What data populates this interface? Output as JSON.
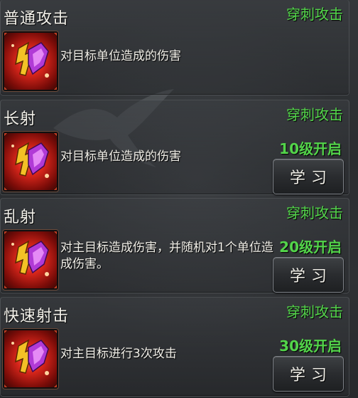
{
  "skills": [
    {
      "name": "普通攻击",
      "type": "穿刺攻击",
      "description": "对目标单位造成的伤害",
      "level_req": "",
      "learn_label": "",
      "icon": "flame-shield-icon"
    },
    {
      "name": "长射",
      "type": "穿刺攻击",
      "description": "对目标单位造成的伤害",
      "level_req": "10级开启",
      "learn_label": "学习",
      "icon": "flame-shield-icon"
    },
    {
      "name": "乱射",
      "type": "穿刺攻击",
      "description": "对主目标造成伤害，并随机对1个单位造成伤害。",
      "level_req": "20级开启",
      "learn_label": "学习",
      "icon": "flame-shield-icon"
    },
    {
      "name": "快速射击",
      "type": "穿刺攻击",
      "description": "对主目标进行3次攻击",
      "level_req": "30级开启",
      "learn_label": "学习",
      "icon": "flame-shield-icon"
    }
  ],
  "colors": {
    "skill_type": "#53d44a",
    "level_req": "#53d44a",
    "text": "#f1efe8"
  }
}
